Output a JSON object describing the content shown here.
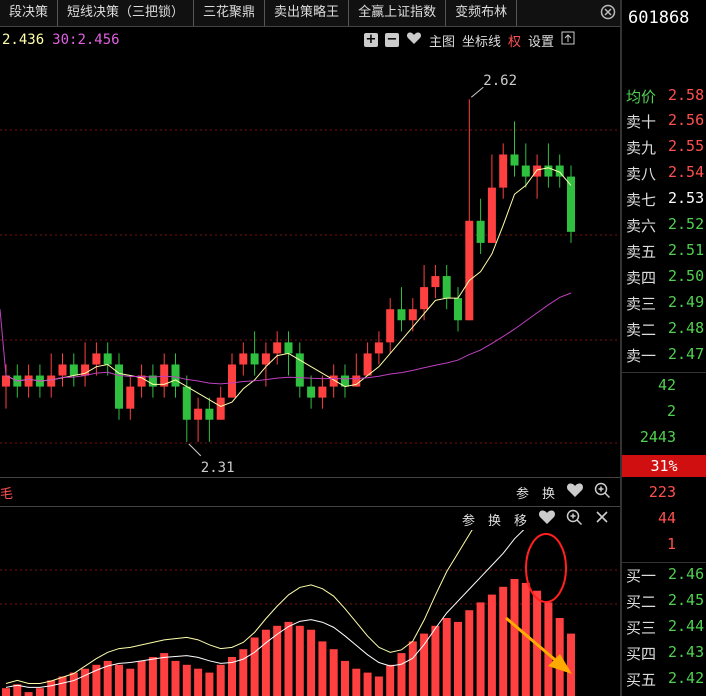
{
  "tabs": [
    "段决策",
    "短线决策（三把锁）",
    "三花聚鼎",
    "卖出策略王",
    "全赢上证指数",
    "变频布林"
  ],
  "stock_code": "601868",
  "ma_legend": {
    "ma5": "2.436",
    "ma30": "30:2.456",
    "ma5_color": "#ffffaa",
    "ma30_color": "#e060e0"
  },
  "toolbar": {
    "plus": "+",
    "minus": "−",
    "main_chart": "主图",
    "axis": "坐标线",
    "rights": "权",
    "settings": "设置"
  },
  "annotations": {
    "high": "2.62",
    "low": "2.31"
  },
  "sub1": {
    "left_label": "毛",
    "param": "参",
    "swap": "换"
  },
  "sub2": {
    "param": "参",
    "swap": "换",
    "move": "移"
  },
  "order_book": {
    "avg_label": "均价",
    "avg_value": "2.58",
    "sell": [
      {
        "label": "卖十",
        "price": "2.56",
        "color": "#ff5050"
      },
      {
        "label": "卖九",
        "price": "2.55",
        "color": "#ff5050"
      },
      {
        "label": "卖八",
        "price": "2.54",
        "color": "#ff5050"
      },
      {
        "label": "卖七",
        "price": "2.53",
        "color": "#ffffff"
      },
      {
        "label": "卖六",
        "price": "2.52",
        "color": "#50d050"
      },
      {
        "label": "卖五",
        "price": "2.51",
        "color": "#50d050"
      },
      {
        "label": "卖四",
        "price": "2.50",
        "color": "#50d050"
      },
      {
        "label": "卖三",
        "price": "2.49",
        "color": "#50d050"
      },
      {
        "label": "卖二",
        "price": "2.48",
        "color": "#50d050"
      },
      {
        "label": "卖一",
        "price": "2.47",
        "color": "#50d050"
      }
    ],
    "stats": [
      "42",
      "2",
      "2443"
    ],
    "pct": "31%",
    "stats2": [
      "223",
      "44",
      "1"
    ],
    "buy": [
      {
        "label": "买一",
        "price": "2.46"
      },
      {
        "label": "买二",
        "price": "2.45"
      },
      {
        "label": "买三",
        "price": "2.44"
      },
      {
        "label": "买四",
        "price": "2.43"
      },
      {
        "label": "买五",
        "price": "2.42"
      }
    ]
  },
  "colors": {
    "up": "#ff4040",
    "down": "#30c040",
    "ma5": "#ffffaa",
    "ma30": "#c040c0"
  },
  "chart_data": {
    "type": "candlestick",
    "y_range": [
      2.28,
      2.66
    ],
    "candles": [
      [
        2.36,
        2.37,
        2.38,
        2.34
      ],
      [
        2.37,
        2.36,
        2.38,
        2.35
      ],
      [
        2.36,
        2.37,
        2.38,
        2.35
      ],
      [
        2.37,
        2.36,
        2.38,
        2.35
      ],
      [
        2.36,
        2.37,
        2.39,
        2.35
      ],
      [
        2.37,
        2.38,
        2.39,
        2.36
      ],
      [
        2.38,
        2.37,
        2.39,
        2.36
      ],
      [
        2.37,
        2.38,
        2.4,
        2.36
      ],
      [
        2.38,
        2.39,
        2.4,
        2.37
      ],
      [
        2.39,
        2.38,
        2.4,
        2.37
      ],
      [
        2.38,
        2.34,
        2.39,
        2.33
      ],
      [
        2.34,
        2.36,
        2.37,
        2.33
      ],
      [
        2.36,
        2.37,
        2.38,
        2.35
      ],
      [
        2.37,
        2.36,
        2.38,
        2.35
      ],
      [
        2.36,
        2.38,
        2.39,
        2.35
      ],
      [
        2.38,
        2.36,
        2.39,
        2.35
      ],
      [
        2.36,
        2.33,
        2.37,
        2.31
      ],
      [
        2.33,
        2.34,
        2.35,
        2.31
      ],
      [
        2.34,
        2.33,
        2.35,
        2.31
      ],
      [
        2.33,
        2.35,
        2.36,
        2.33
      ],
      [
        2.35,
        2.38,
        2.39,
        2.35
      ],
      [
        2.38,
        2.39,
        2.4,
        2.37
      ],
      [
        2.39,
        2.38,
        2.41,
        2.37
      ],
      [
        2.38,
        2.39,
        2.4,
        2.36
      ],
      [
        2.39,
        2.4,
        2.41,
        2.38
      ],
      [
        2.4,
        2.39,
        2.41,
        2.37
      ],
      [
        2.39,
        2.36,
        2.4,
        2.35
      ],
      [
        2.36,
        2.35,
        2.37,
        2.34
      ],
      [
        2.35,
        2.36,
        2.37,
        2.34
      ],
      [
        2.36,
        2.37,
        2.38,
        2.35
      ],
      [
        2.37,
        2.36,
        2.38,
        2.35
      ],
      [
        2.36,
        2.37,
        2.39,
        2.36
      ],
      [
        2.37,
        2.39,
        2.4,
        2.37
      ],
      [
        2.39,
        2.4,
        2.41,
        2.38
      ],
      [
        2.4,
        2.43,
        2.44,
        2.39
      ],
      [
        2.43,
        2.42,
        2.45,
        2.41
      ],
      [
        2.42,
        2.43,
        2.44,
        2.41
      ],
      [
        2.43,
        2.45,
        2.47,
        2.42
      ],
      [
        2.45,
        2.46,
        2.47,
        2.44
      ],
      [
        2.46,
        2.44,
        2.47,
        2.43
      ],
      [
        2.44,
        2.42,
        2.45,
        2.41
      ],
      [
        2.42,
        2.51,
        2.62,
        2.42
      ],
      [
        2.51,
        2.49,
        2.53,
        2.48
      ],
      [
        2.49,
        2.54,
        2.57,
        2.49
      ],
      [
        2.54,
        2.57,
        2.58,
        2.53
      ],
      [
        2.57,
        2.56,
        2.6,
        2.55
      ],
      [
        2.56,
        2.55,
        2.58,
        2.54
      ],
      [
        2.55,
        2.56,
        2.57,
        2.53
      ],
      [
        2.56,
        2.55,
        2.58,
        2.54
      ],
      [
        2.56,
        2.55,
        2.57,
        2.54
      ],
      [
        2.55,
        2.5,
        2.56,
        2.49
      ]
    ],
    "sub_values": [
      2,
      3,
      1,
      2,
      4,
      5,
      6,
      7,
      8,
      9,
      8,
      7,
      9,
      10,
      11,
      9,
      8,
      7,
      6,
      8,
      10,
      12,
      15,
      17,
      18,
      19,
      18,
      17,
      14,
      12,
      9,
      7,
      6,
      5,
      8,
      11,
      14,
      16,
      18,
      20,
      19,
      22,
      24,
      26,
      28,
      30,
      29,
      27,
      24,
      20,
      16
    ],
    "sub_range": [
      0,
      40
    ]
  }
}
